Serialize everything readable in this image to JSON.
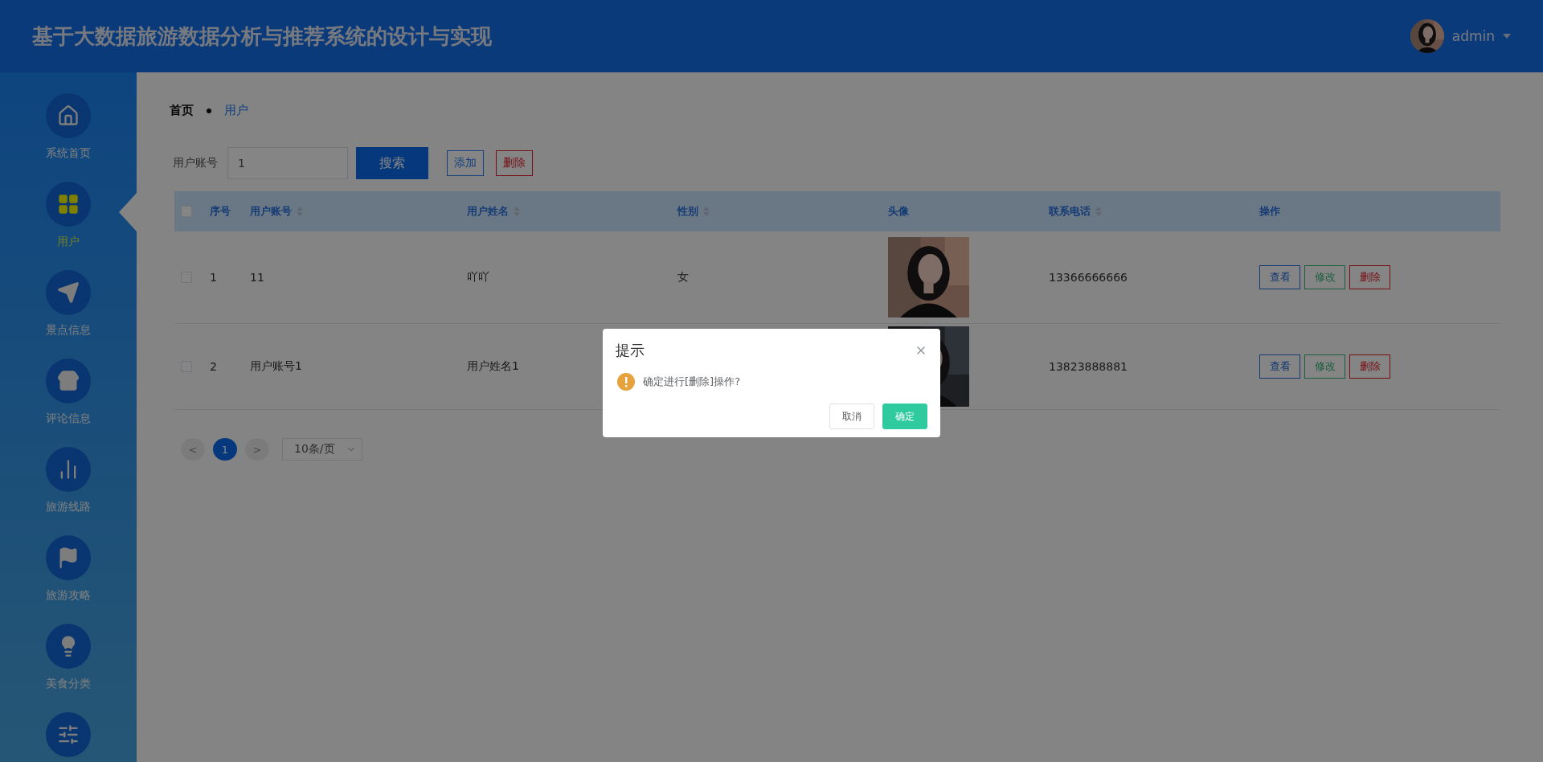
{
  "header": {
    "title": "基于大数据旅游数据分析与推荐系统的设计与实现",
    "user": "admin"
  },
  "sidebar": {
    "items": [
      {
        "label": "系统首页",
        "kind": "house",
        "selected": false
      },
      {
        "label": "用户",
        "kind": "grid",
        "selected": true
      },
      {
        "label": "景点信息",
        "kind": "plane",
        "selected": false
      },
      {
        "label": "评论信息",
        "kind": "store",
        "selected": false
      },
      {
        "label": "旅游线路",
        "kind": "bars",
        "selected": false
      },
      {
        "label": "旅游攻略",
        "kind": "flag",
        "selected": false
      },
      {
        "label": "美食分类",
        "kind": "bulb",
        "selected": false
      },
      {
        "kind": "sliders",
        "selected": false
      }
    ]
  },
  "breadcrumb": [
    {
      "label": "首页",
      "current": false
    },
    {
      "label": "用户",
      "current": true
    }
  ],
  "search": {
    "label": "用户账号",
    "value": "1",
    "button": "搜索"
  },
  "actions": [
    {
      "label": "添加",
      "kind": "add"
    },
    {
      "label": "删除",
      "kind": "delete"
    }
  ],
  "table": {
    "all_checked": false,
    "columns": [
      {
        "label": "序号",
        "sortable": false
      },
      {
        "label": "用户账号",
        "sortable": true
      },
      {
        "label": "用户姓名",
        "sortable": true
      },
      {
        "label": "性别",
        "sortable": true
      },
      {
        "label": "头像",
        "sortable": false
      },
      {
        "label": "联系电话",
        "sortable": true
      },
      {
        "label": "操作",
        "sortable": false
      }
    ],
    "rows": [
      {
        "checked": false,
        "index": "1",
        "account": "11",
        "name": "吖吖",
        "gender": "女",
        "phone": "13366666666",
        "actions": [
          {
            "label": "查看",
            "kind": "view"
          },
          {
            "label": "修改",
            "kind": "edit"
          },
          {
            "label": "删除",
            "kind": "delete"
          }
        ]
      },
      {
        "checked": false,
        "index": "2",
        "account": "用户账号1",
        "name": "用户姓名1",
        "phone": "13823888881",
        "actions": [
          {
            "label": "查看",
            "kind": "view"
          },
          {
            "label": "修改",
            "kind": "edit"
          },
          {
            "label": "删除",
            "kind": "delete"
          }
        ]
      }
    ]
  },
  "pagination": {
    "prev": "<",
    "pages": [
      {
        "label": "1",
        "selected": true
      }
    ],
    "next": ">",
    "page_size": "10条/页"
  },
  "dialog": {
    "title": "提示",
    "message": "确定进行[删除]操作?",
    "buttons": [
      {
        "label": "取消",
        "kind": "cancel"
      },
      {
        "label": "确定",
        "kind": "confirm"
      }
    ]
  }
}
